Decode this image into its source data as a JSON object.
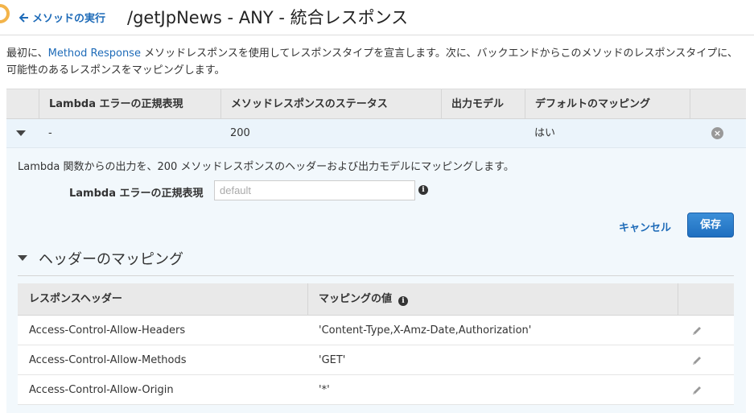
{
  "header": {
    "back_label": "メソッドの実行",
    "title": "/getJpNews - ANY - 統合レスポンス"
  },
  "intro": {
    "before": "最初に、",
    "link": "Method Response",
    "after": " メソッドレスポンスを使用してレスポンスタイプを宣言します。次に、バックエンドからこのメソッドのレスポンスタイプに、可能性のあるレスポンスをマッピングします。"
  },
  "main_table": {
    "columns": [
      "Lambda エラーの正規表現",
      "メソッドレスポンスのステータス",
      "出力モデル",
      "デフォルトのマッピング"
    ],
    "row": {
      "regex": "-",
      "status": "200",
      "model": "",
      "default": "はい"
    }
  },
  "panel": {
    "description": "Lambda 関数からの出力を、200 メソッドレスポンスのヘッダーおよび出力モデルにマッピングします。",
    "regex_label": "Lambda エラーの正規表現",
    "regex_placeholder": "default",
    "cancel_label": "キャンセル",
    "save_label": "保存",
    "section_title": "ヘッダーのマッピング"
  },
  "header_mapping": {
    "columns": [
      "レスポンスヘッダー",
      "マッピングの値"
    ],
    "rows": [
      {
        "header": "Access-Control-Allow-Headers",
        "value": "'Content-Type,X-Amz-Date,Authorization'"
      },
      {
        "header": "Access-Control-Allow-Methods",
        "value": "'GET'"
      },
      {
        "header": "Access-Control-Allow-Origin",
        "value": "'*'"
      }
    ]
  },
  "colors": {
    "link": "#1e6bb8",
    "selected_row": "#ebf4fb",
    "panel": "#f2f8fc",
    "primary_button": "#1f6fc0",
    "accent_ring": "#f3b44a"
  },
  "icons": [
    "ring-icon",
    "back-arrow-icon",
    "caret-down-icon",
    "remove-icon",
    "info-icon",
    "pencil-icon"
  ]
}
